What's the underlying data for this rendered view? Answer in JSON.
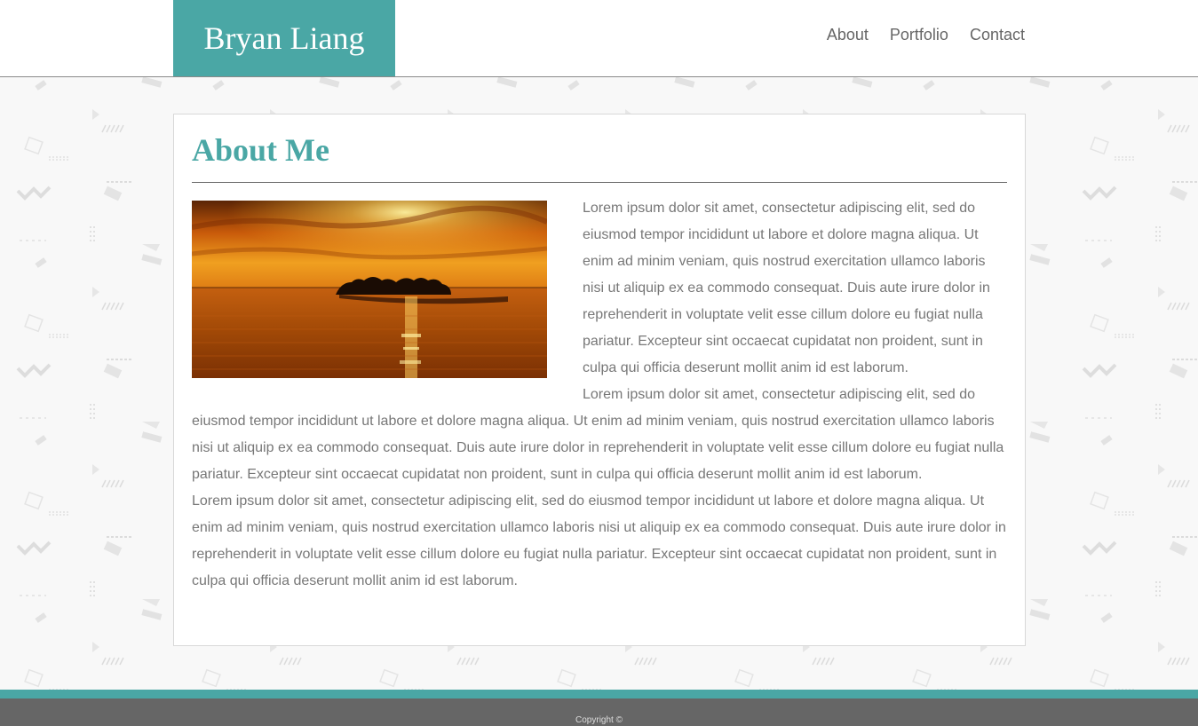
{
  "header": {
    "logo_text": "Bryan Liang",
    "nav": [
      {
        "label": "About"
      },
      {
        "label": "Portfolio"
      },
      {
        "label": "Contact"
      }
    ]
  },
  "main": {
    "title": "About Me",
    "image_alt": "sunset-over-lake-island",
    "paragraphs": [
      "Lorem ipsum dolor sit amet, consectetur adipiscing elit, sed do eiusmod tempor incididunt ut labore et dolore magna aliqua. Ut enim ad minim veniam, quis nostrud exercitation ullamco laboris nisi ut aliquip ex ea commodo consequat. Duis aute irure dolor in reprehenderit in voluptate velit esse cillum dolore eu fugiat nulla pariatur. Excepteur sint occaecat cupidatat non proident, sunt in culpa qui officia deserunt mollit anim id est laborum.",
      "Lorem ipsum dolor sit amet, consectetur adipiscing elit, sed do eiusmod tempor incididunt ut labore et dolore magna aliqua. Ut enim ad minim veniam, quis nostrud exercitation ullamco laboris nisi ut aliquip ex ea commodo consequat. Duis aute irure dolor in reprehenderit in voluptate velit esse cillum dolore eu fugiat nulla pariatur. Excepteur sint occaecat cupidatat non proident, sunt in culpa qui officia deserunt mollit anim id est laborum.",
      "Lorem ipsum dolor sit amet, consectetur adipiscing elit, sed do eiusmod tempor incididunt ut labore et dolore magna aliqua. Ut enim ad minim veniam, quis nostrud exercitation ullamco laboris nisi ut aliquip ex ea commodo consequat. Duis aute irure dolor in reprehenderit in voluptate velit esse cillum dolore eu fugiat nulla pariatur. Excepteur sint occaecat cupidatat non proident, sunt in culpa qui officia deserunt mollit anim id est laborum."
    ]
  },
  "footer": {
    "copyright": "Copyright ©"
  },
  "colors": {
    "accent": "#4aa7a5",
    "text": "#777777",
    "footer_bg": "#666666"
  }
}
